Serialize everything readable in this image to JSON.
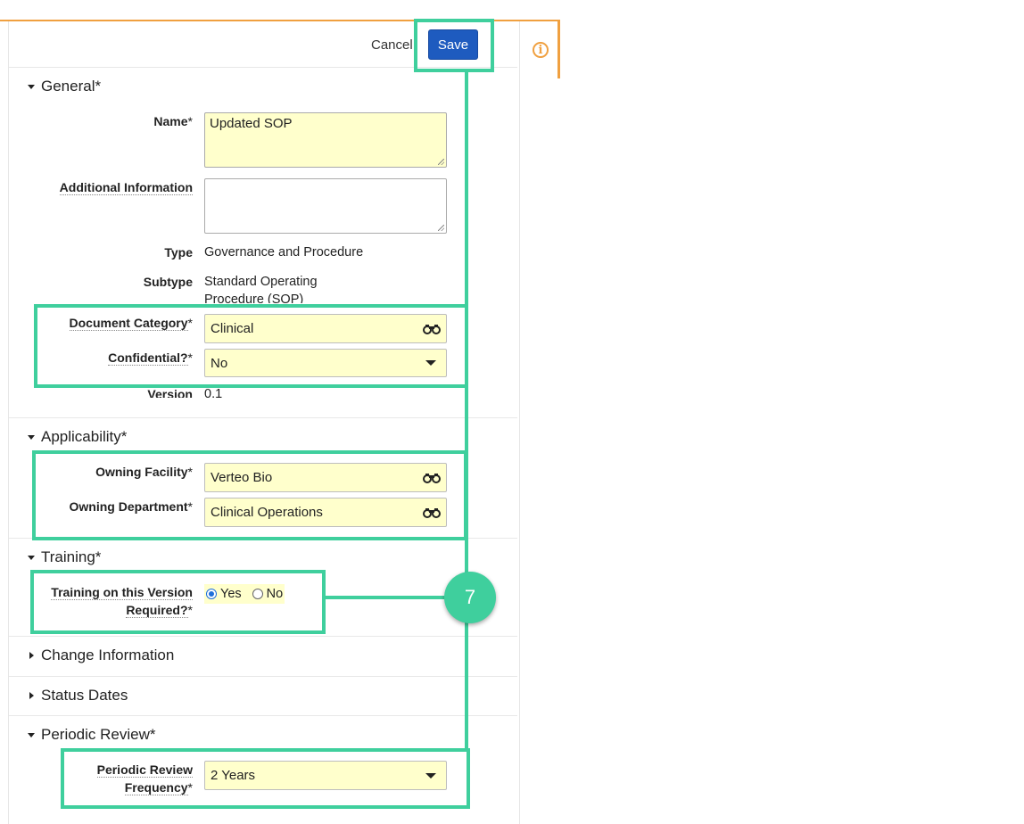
{
  "toolbar": {
    "cancel_label": "Cancel",
    "save_label": "Save"
  },
  "callout_number": "7",
  "sections": {
    "general": {
      "title": "General*",
      "name": {
        "label": "Name",
        "req": "*",
        "value": "Updated SOP"
      },
      "additional_info": {
        "label": "Additional Information",
        "value": ""
      },
      "type": {
        "label": "Type",
        "value": "Governance and Procedure"
      },
      "subtype": {
        "label": "Subtype",
        "value_line1": "Standard Operating",
        "value_line2": "Procedure (SOP)"
      },
      "document_category": {
        "label": "Document Category",
        "req": "*",
        "value": "Clinical"
      },
      "confidential": {
        "label": "Confidential?",
        "req": "*",
        "value": "No"
      },
      "version": {
        "label": "Version",
        "value": "0.1"
      }
    },
    "applicability": {
      "title": "Applicability*",
      "owning_facility": {
        "label": "Owning Facility",
        "req": "*",
        "value": "Verteo Bio"
      },
      "owning_department": {
        "label": "Owning Department",
        "req": "*",
        "value": "Clinical Operations"
      }
    },
    "training": {
      "title": "Training*",
      "training_required": {
        "label_line1": "Training on this Version",
        "label_line2": "Required?",
        "req": "*",
        "option_yes": "Yes",
        "option_no": "No",
        "selected": "Yes"
      }
    },
    "change_information": {
      "title": "Change Information"
    },
    "status_dates": {
      "title": "Status Dates"
    },
    "periodic_review": {
      "title": "Periodic Review*",
      "frequency": {
        "label_line1": "Periodic Review",
        "label_line2": "Frequency",
        "req": "*",
        "value": "2 Years"
      }
    }
  },
  "icons": {
    "info": "info-icon",
    "lookup": "binoculars-icon",
    "dropdown": "chevron-down-icon"
  },
  "colors": {
    "highlight": "#3fcf9d",
    "accent_orange": "#f0a040",
    "save_button": "#1e5bbf",
    "required_field": "#ffffcc"
  }
}
